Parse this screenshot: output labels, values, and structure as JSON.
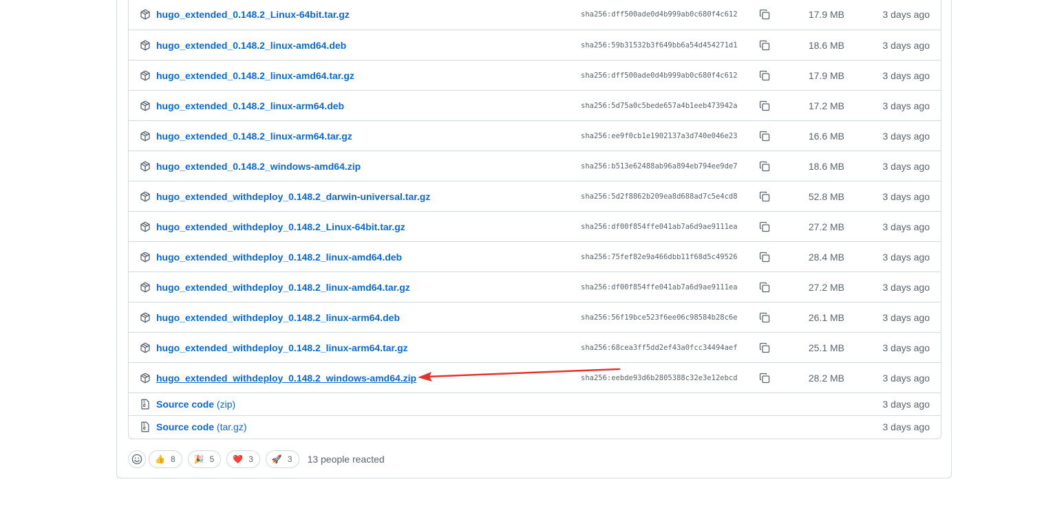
{
  "assets": [
    {
      "name": "hugo_extended_0.148.2_Linux-64bit.tar.gz",
      "sha": "sha256:dff500ade0d4b999ab0c680f4c612",
      "size": "17.9 MB",
      "date": "3 days ago"
    },
    {
      "name": "hugo_extended_0.148.2_linux-amd64.deb",
      "sha": "sha256:59b31532b3f649bb6a54d454271d1",
      "size": "18.6 MB",
      "date": "3 days ago"
    },
    {
      "name": "hugo_extended_0.148.2_linux-amd64.tar.gz",
      "sha": "sha256:dff500ade0d4b999ab0c680f4c612",
      "size": "17.9 MB",
      "date": "3 days ago"
    },
    {
      "name": "hugo_extended_0.148.2_linux-arm64.deb",
      "sha": "sha256:5d75a0c5bede657a4b1eeb473942a",
      "size": "17.2 MB",
      "date": "3 days ago"
    },
    {
      "name": "hugo_extended_0.148.2_linux-arm64.tar.gz",
      "sha": "sha256:ee9f0cb1e1902137a3d740e046e23",
      "size": "16.6 MB",
      "date": "3 days ago"
    },
    {
      "name": "hugo_extended_0.148.2_windows-amd64.zip",
      "sha": "sha256:b513e62488ab96a894eb794ee9de7",
      "size": "18.6 MB",
      "date": "3 days ago"
    },
    {
      "name": "hugo_extended_withdeploy_0.148.2_darwin-universal.tar.gz",
      "sha": "sha256:5d2f8862b209ea8d688ad7c5e4cd8",
      "size": "52.8 MB",
      "date": "3 days ago"
    },
    {
      "name": "hugo_extended_withdeploy_0.148.2_Linux-64bit.tar.gz",
      "sha": "sha256:df00f854ffe041ab7a6d9ae9111ea",
      "size": "27.2 MB",
      "date": "3 days ago"
    },
    {
      "name": "hugo_extended_withdeploy_0.148.2_linux-amd64.deb",
      "sha": "sha256:75fef82e9a466dbb11f68d5c49526",
      "size": "28.4 MB",
      "date": "3 days ago"
    },
    {
      "name": "hugo_extended_withdeploy_0.148.2_linux-amd64.tar.gz",
      "sha": "sha256:df00f854ffe041ab7a6d9ae9111ea",
      "size": "27.2 MB",
      "date": "3 days ago"
    },
    {
      "name": "hugo_extended_withdeploy_0.148.2_linux-arm64.deb",
      "sha": "sha256:56f19bce523f6ee06c98584b28c6e",
      "size": "26.1 MB",
      "date": "3 days ago"
    },
    {
      "name": "hugo_extended_withdeploy_0.148.2_linux-arm64.tar.gz",
      "sha": "sha256:68cea3ff5dd2ef43a0fcc34494aef",
      "size": "25.1 MB",
      "date": "3 days ago"
    },
    {
      "name": "hugo_extended_withdeploy_0.148.2_windows-amd64.zip",
      "sha": "sha256:eebde93d6b2805388c32e3e12ebcd",
      "size": "28.2 MB",
      "date": "3 days ago"
    }
  ],
  "source_code": [
    {
      "label": "Source code",
      "format": "(zip)",
      "date": "3 days ago"
    },
    {
      "label": "Source code",
      "format": "(tar.gz)",
      "date": "3 days ago"
    }
  ],
  "reactions": [
    {
      "emoji": "👍",
      "count": "8"
    },
    {
      "emoji": "🎉",
      "count": "5"
    },
    {
      "emoji": "❤️",
      "count": "3"
    },
    {
      "emoji": "🚀",
      "count": "3"
    }
  ],
  "reactions_summary": "13 people reacted",
  "icons": {
    "package": "package-icon",
    "file_zip": "file-zip-icon",
    "copy": "copy-icon",
    "smiley": "smiley-icon"
  },
  "colors": {
    "link": "#0969da",
    "muted": "#59636e",
    "border": "#d1d9e0",
    "annotation": "#e5302b"
  }
}
